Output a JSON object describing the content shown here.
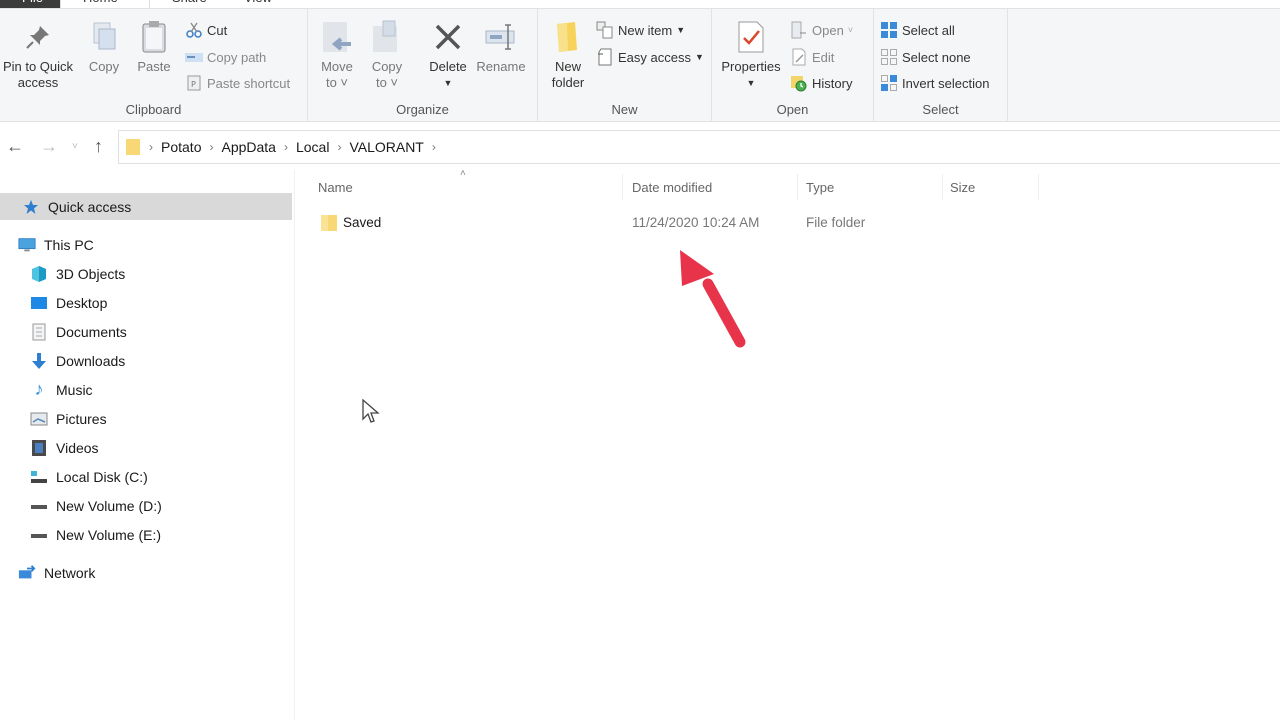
{
  "window": {
    "tabs": [
      {
        "label": "File"
      },
      {
        "label": "Home"
      },
      {
        "label": "Share"
      },
      {
        "label": "View"
      }
    ]
  },
  "ribbon": {
    "clipboard": {
      "label": "Clipboard",
      "pin": "Pin to Quick access",
      "pin_line1": "Pin to Quick",
      "pin_line2": "access",
      "copy": "Copy",
      "paste": "Paste",
      "cut": "Cut",
      "copy_path": "Copy path",
      "paste_shortcut": "Paste shortcut"
    },
    "organize": {
      "label": "Organize",
      "move_to_1": "Move",
      "move_to_2": "to",
      "copy_to_1": "Copy",
      "copy_to_2": "to",
      "delete": "Delete",
      "rename": "Rename"
    },
    "new": {
      "label": "New",
      "new_folder_1": "New",
      "new_folder_2": "folder",
      "new_item": "New item",
      "easy_access": "Easy access"
    },
    "open": {
      "label": "Open",
      "properties": "Properties",
      "open": "Open",
      "edit": "Edit",
      "history": "History"
    },
    "select": {
      "label": "Select",
      "select_all": "Select all",
      "select_none": "Select none",
      "invert_selection": "Invert selection"
    }
  },
  "address": {
    "breadcrumbs": [
      "Potato",
      "AppData",
      "Local",
      "VALORANT"
    ]
  },
  "sidebar": {
    "quick_access": "Quick access",
    "this_pc": "This PC",
    "items": [
      {
        "label": "3D Objects",
        "icon": "3d-objects-icon"
      },
      {
        "label": "Desktop",
        "icon": "desktop-icon"
      },
      {
        "label": "Documents",
        "icon": "documents-icon"
      },
      {
        "label": "Downloads",
        "icon": "downloads-icon"
      },
      {
        "label": "Music",
        "icon": "music-icon"
      },
      {
        "label": "Pictures",
        "icon": "pictures-icon"
      },
      {
        "label": "Videos",
        "icon": "videos-icon"
      },
      {
        "label": "Local Disk (C:)",
        "icon": "local-disk-icon"
      },
      {
        "label": "New Volume (D:)",
        "icon": "drive-icon"
      },
      {
        "label": "New Volume (E:)",
        "icon": "drive-icon"
      }
    ],
    "network": "Network"
  },
  "file_list": {
    "columns": [
      "Name",
      "Date modified",
      "Type",
      "Size"
    ],
    "rows": [
      {
        "name": "Saved",
        "date_modified": "11/24/2020 10:24 AM",
        "type": "File folder",
        "size": ""
      }
    ]
  },
  "colors": {
    "annotation_arrow": "#e8344a",
    "folder": "#f8d775",
    "selection": "#d9d9d9"
  }
}
